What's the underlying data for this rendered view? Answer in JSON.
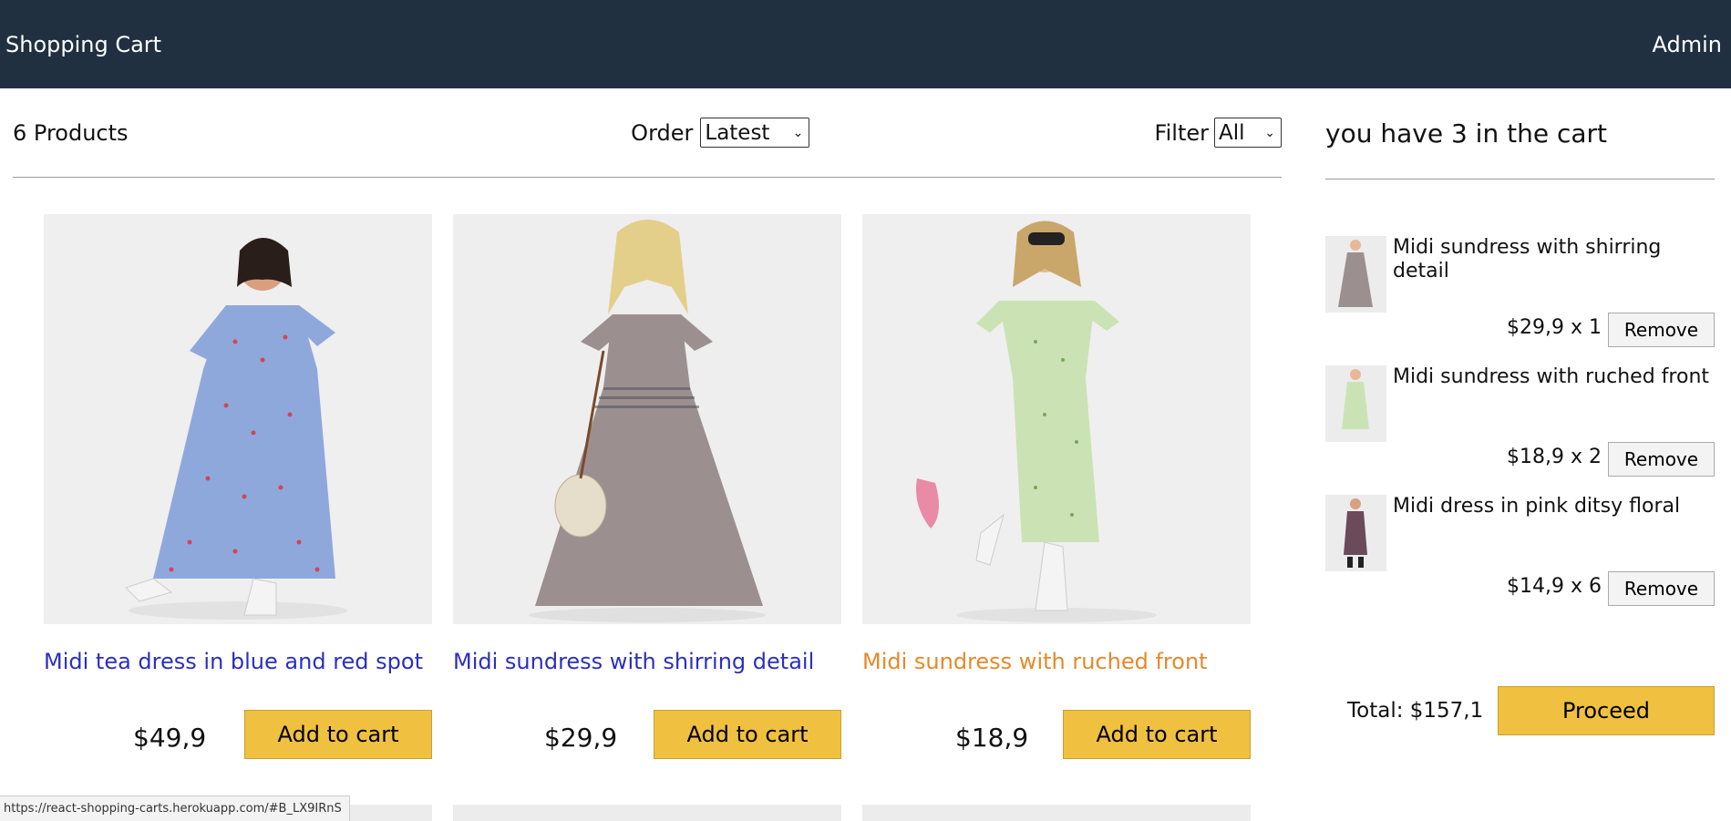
{
  "header": {
    "brand": "Shopping Cart",
    "admin_link": "Admin"
  },
  "filter_bar": {
    "count_text": "6 Products",
    "order_label": "Order",
    "order_selected": "Latest",
    "filter_label": "Filter",
    "filter_selected": "All"
  },
  "products": [
    {
      "title": "Midi tea dress in blue and red spot",
      "price": "$49,9",
      "button": "Add to cart",
      "dress_color": "#8fa8dc",
      "dot_color": "#d0455a",
      "bg": "#efefef",
      "hovered": false
    },
    {
      "title": "Midi sundress with shirring detail",
      "price": "$29,9",
      "button": "Add to cart",
      "dress_color": "#9c8f8f",
      "dot_color": "#4a4a5a",
      "bg": "#eeeeee",
      "hovered": false
    },
    {
      "title": "Midi sundress with ruched front",
      "price": "$18,9",
      "button": "Add to cart",
      "dress_color": "#cbe3b4",
      "dot_color": "#7aa55a",
      "bg": "#efefef",
      "hovered": true
    }
  ],
  "cart": {
    "heading": "you have 3 in the cart",
    "items": [
      {
        "name": "Midi sundress with shirring detail",
        "qty_text": "$29,9 x 1",
        "remove": "Remove",
        "color": "#9c8f8f"
      },
      {
        "name": "Midi sundress with ruched front",
        "qty_text": "$18,9 x 2",
        "remove": "Remove",
        "color": "#cbe3b4"
      },
      {
        "name": "Midi dress in pink ditsy floral",
        "qty_text": "$14,9 x 6",
        "remove": "Remove",
        "color": "#6b4a5a"
      }
    ],
    "total": "Total: $157,1",
    "proceed": "Proceed"
  },
  "status_url": "https://react-shopping-carts.herokuapp.com/#B_LX9IRnS",
  "colors": {
    "header_bg": "#203040",
    "button_yellow": "#f0c040",
    "link_blue": "#2b2fbf",
    "link_hover": "#e6892a"
  }
}
